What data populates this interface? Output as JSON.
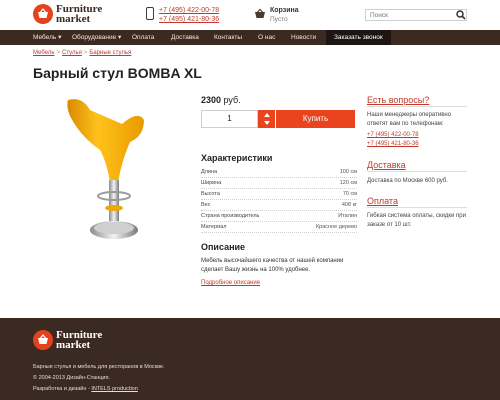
{
  "header": {
    "logo_line1": "Furniture",
    "logo_line2": "market",
    "phone1": "+7 (495) 422-00-78",
    "phone2": "+7 (495) 421-80-36",
    "cart_title": "Корзина",
    "cart_status": "Пусто",
    "search_placeholder": "Поиск"
  },
  "nav": {
    "items": [
      {
        "label": "Мебель ▾"
      },
      {
        "label": "Оборудование ▾"
      },
      {
        "label": "Оплата"
      },
      {
        "label": "Доставка"
      },
      {
        "label": "Контакты"
      },
      {
        "label": "О нас"
      },
      {
        "label": "Новости"
      },
      {
        "label": "Заказать звонок"
      }
    ]
  },
  "breadcrumb": [
    "Мебель",
    "Стулья",
    "Барные стулья"
  ],
  "product": {
    "title": "Барный стул BOMBA XL",
    "price_value": "2300",
    "price_unit": " руб.",
    "quantity": "1",
    "buy_label": "Купить",
    "specs_title": "Характеристики",
    "specs": [
      {
        "key": "Длина",
        "value": "100 см"
      },
      {
        "key": "Ширина",
        "value": "120 см"
      },
      {
        "key": "Высота",
        "value": "70 см"
      },
      {
        "key": "Вес",
        "value": "408 кг"
      },
      {
        "key": "Страна производитель",
        "value": "Италия"
      },
      {
        "key": "Материал",
        "value": "Красное дерево"
      }
    ],
    "description_title": "Описание",
    "description_text": "Мебель высочайшего качества от нашей компании сделает Вашу жизнь на 100% удобнее.",
    "description_link": "Подробное описание"
  },
  "sidebar": {
    "questions_title": "Есть вопросы?",
    "questions_text": "Наши менеджеры оперативно ответят вам по телефонам:",
    "phone1": "+7 (495) 422-00-78",
    "phone2": "+7 (495) 421-80-36",
    "delivery_title": "Доставка",
    "delivery_text": "Доставка по Москве 600 руб.",
    "payment_title": "Оплата",
    "payment_text": "Гибкая система оплаты, скидки при заказе от 10 шт."
  },
  "footer": {
    "logo_line1": "Furniture",
    "logo_line2": "market",
    "tagline": "Барные стулья и мебель для ресторанов в Москве.",
    "copyright": "© 2004-2013 Дизайн-Станция.",
    "credits_prefix": "Разработка и дизайн - ",
    "credits_link": "INTELS production"
  },
  "colors": {
    "accent": "#e9441e",
    "brown": "#3b2a22",
    "link": "#c0392b"
  }
}
